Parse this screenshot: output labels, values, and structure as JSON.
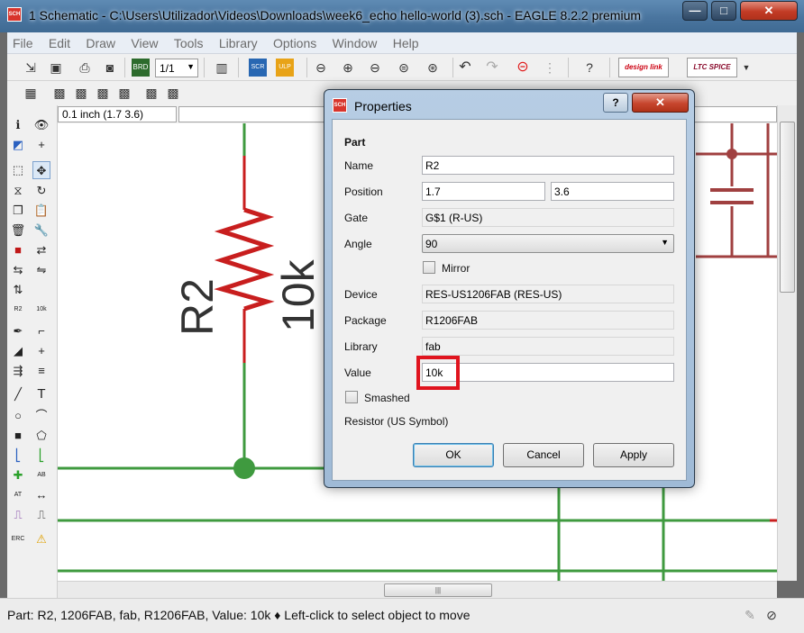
{
  "window": {
    "title": "1 Schematic - C:\\Users\\Utilizador\\Videos\\Downloads\\week6_echo hello-world  (3).sch - EAGLE 8.2.2 premium",
    "icon_text": "SCH",
    "minimize": "—",
    "maximize": "□",
    "close": "✕"
  },
  "menu": [
    "File",
    "Edit",
    "Draw",
    "View",
    "Tools",
    "Library",
    "Options",
    "Window",
    "Help"
  ],
  "toolbar": {
    "sheet_combo": "1/1",
    "brand1": "design link",
    "brand2": "LTC SPICE"
  },
  "coord_display": "0.1 inch (1.7 3.6)",
  "schematic": {
    "part_name": "R2",
    "part_value": "10k"
  },
  "dialog": {
    "title": "Properties",
    "icon_text": "SCH",
    "help": "?",
    "close": "✕",
    "section": "Part",
    "labels": {
      "name": "Name",
      "position": "Position",
      "gate": "Gate",
      "angle": "Angle",
      "mirror": "Mirror",
      "device": "Device",
      "package": "Package",
      "library": "Library",
      "value": "Value",
      "smashed": "Smashed"
    },
    "values": {
      "name": "R2",
      "position_x": "1.7",
      "position_y": "3.6",
      "gate": "G$1 (R-US)",
      "angle": "90",
      "device": "RES-US1206FAB (RES-US)",
      "package": "R1206FAB",
      "library": "fab",
      "value": "10k"
    },
    "mirror_checked": false,
    "smashed_checked": false,
    "description": "Resistor (US Symbol)",
    "buttons": {
      "ok": "OK",
      "cancel": "Cancel",
      "apply": "Apply"
    }
  },
  "status": "Part: R2, 1206FAB, fab, R1206FAB, Value: 10k ♦ Left-click to select object to move",
  "colors": {
    "wire_green": "#3f9a3f",
    "resistor_red": "#c81e1e",
    "highlight_red": "#e0141e",
    "net_darkred": "#a04040"
  }
}
